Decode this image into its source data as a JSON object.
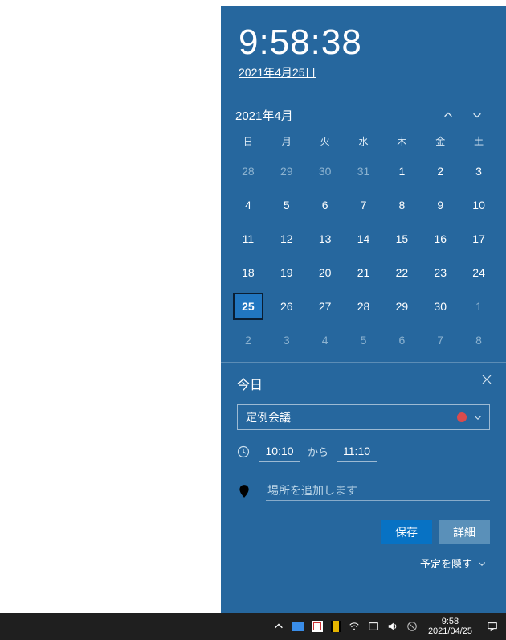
{
  "clock": {
    "time": "9:58:38",
    "date": "2021年4月25日"
  },
  "calendar": {
    "title": "2021年4月",
    "dow": [
      "日",
      "月",
      "火",
      "水",
      "木",
      "金",
      "土"
    ],
    "days": [
      {
        "n": "28",
        "other": true
      },
      {
        "n": "29",
        "other": true
      },
      {
        "n": "30",
        "other": true
      },
      {
        "n": "31",
        "other": true
      },
      {
        "n": "1"
      },
      {
        "n": "2"
      },
      {
        "n": "3"
      },
      {
        "n": "4"
      },
      {
        "n": "5"
      },
      {
        "n": "6"
      },
      {
        "n": "7"
      },
      {
        "n": "8"
      },
      {
        "n": "9"
      },
      {
        "n": "10"
      },
      {
        "n": "11"
      },
      {
        "n": "12"
      },
      {
        "n": "13"
      },
      {
        "n": "14"
      },
      {
        "n": "15"
      },
      {
        "n": "16"
      },
      {
        "n": "17"
      },
      {
        "n": "18"
      },
      {
        "n": "19"
      },
      {
        "n": "20"
      },
      {
        "n": "21"
      },
      {
        "n": "22"
      },
      {
        "n": "23"
      },
      {
        "n": "24"
      },
      {
        "n": "25",
        "today": true
      },
      {
        "n": "26"
      },
      {
        "n": "27"
      },
      {
        "n": "28"
      },
      {
        "n": "29"
      },
      {
        "n": "30"
      },
      {
        "n": "1",
        "other": true
      },
      {
        "n": "2",
        "other": true
      },
      {
        "n": "3",
        "other": true
      },
      {
        "n": "4",
        "other": true
      },
      {
        "n": "5",
        "other": true
      },
      {
        "n": "6",
        "other": true
      },
      {
        "n": "7",
        "other": true
      },
      {
        "n": "8",
        "other": true
      }
    ]
  },
  "event": {
    "title": "今日",
    "subject": "定例会議",
    "start": "10:10",
    "from_label": "から",
    "end": "11:10",
    "location_placeholder": "場所を追加します",
    "save_label": "保存",
    "detail_label": "詳細",
    "hide_label": "予定を隠す"
  },
  "taskbar": {
    "time": "9:58",
    "date": "2021/04/25"
  }
}
